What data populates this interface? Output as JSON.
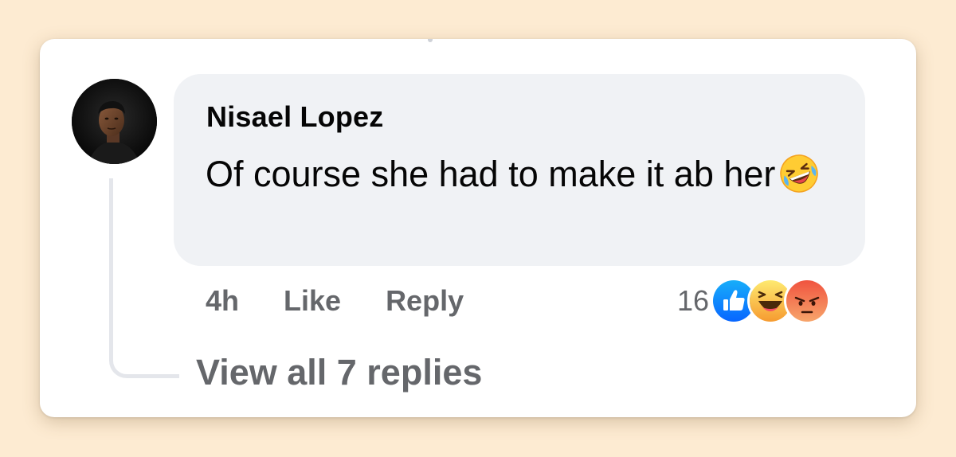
{
  "comment": {
    "author": "Nisael Lopez",
    "text": "Of course she had to make it ab her",
    "text_emoji": "rolling-on-floor-laughing-emoji",
    "avatar_icon": "user-avatar-photo"
  },
  "actions": {
    "time": "4h",
    "like": "Like",
    "reply": "Reply"
  },
  "reactions": {
    "count": "16",
    "types": [
      "like-reaction-icon",
      "haha-reaction-icon",
      "angry-reaction-icon"
    ]
  },
  "replies": {
    "label": "View all 7 replies"
  },
  "colors": {
    "page_bg": "#fdebd2",
    "bubble_bg": "#f0f2f5",
    "secondary_text": "#65676b",
    "like_blue": "#1877f2"
  }
}
